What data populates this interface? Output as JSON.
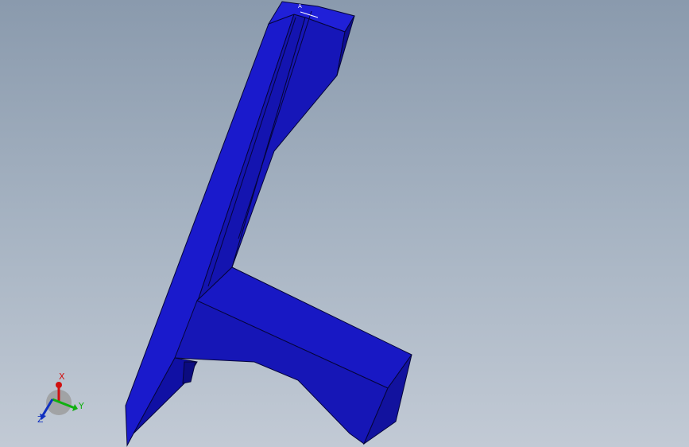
{
  "viewport": {
    "background_top": "#8a9aad",
    "background_bottom": "#c2cad5"
  },
  "model": {
    "color_front": "#1a1acc",
    "color_mid": "#1414b0",
    "color_dark": "#0b0b80",
    "color_edge": "#05053a"
  },
  "annotation": {
    "label": "A"
  },
  "triad": {
    "x_label": "X",
    "y_label": "Y",
    "z_label": "Z",
    "x_color": "#d01010",
    "y_color": "#10b010",
    "z_color": "#1030c0",
    "icon": "coordinate-triad-icon"
  }
}
